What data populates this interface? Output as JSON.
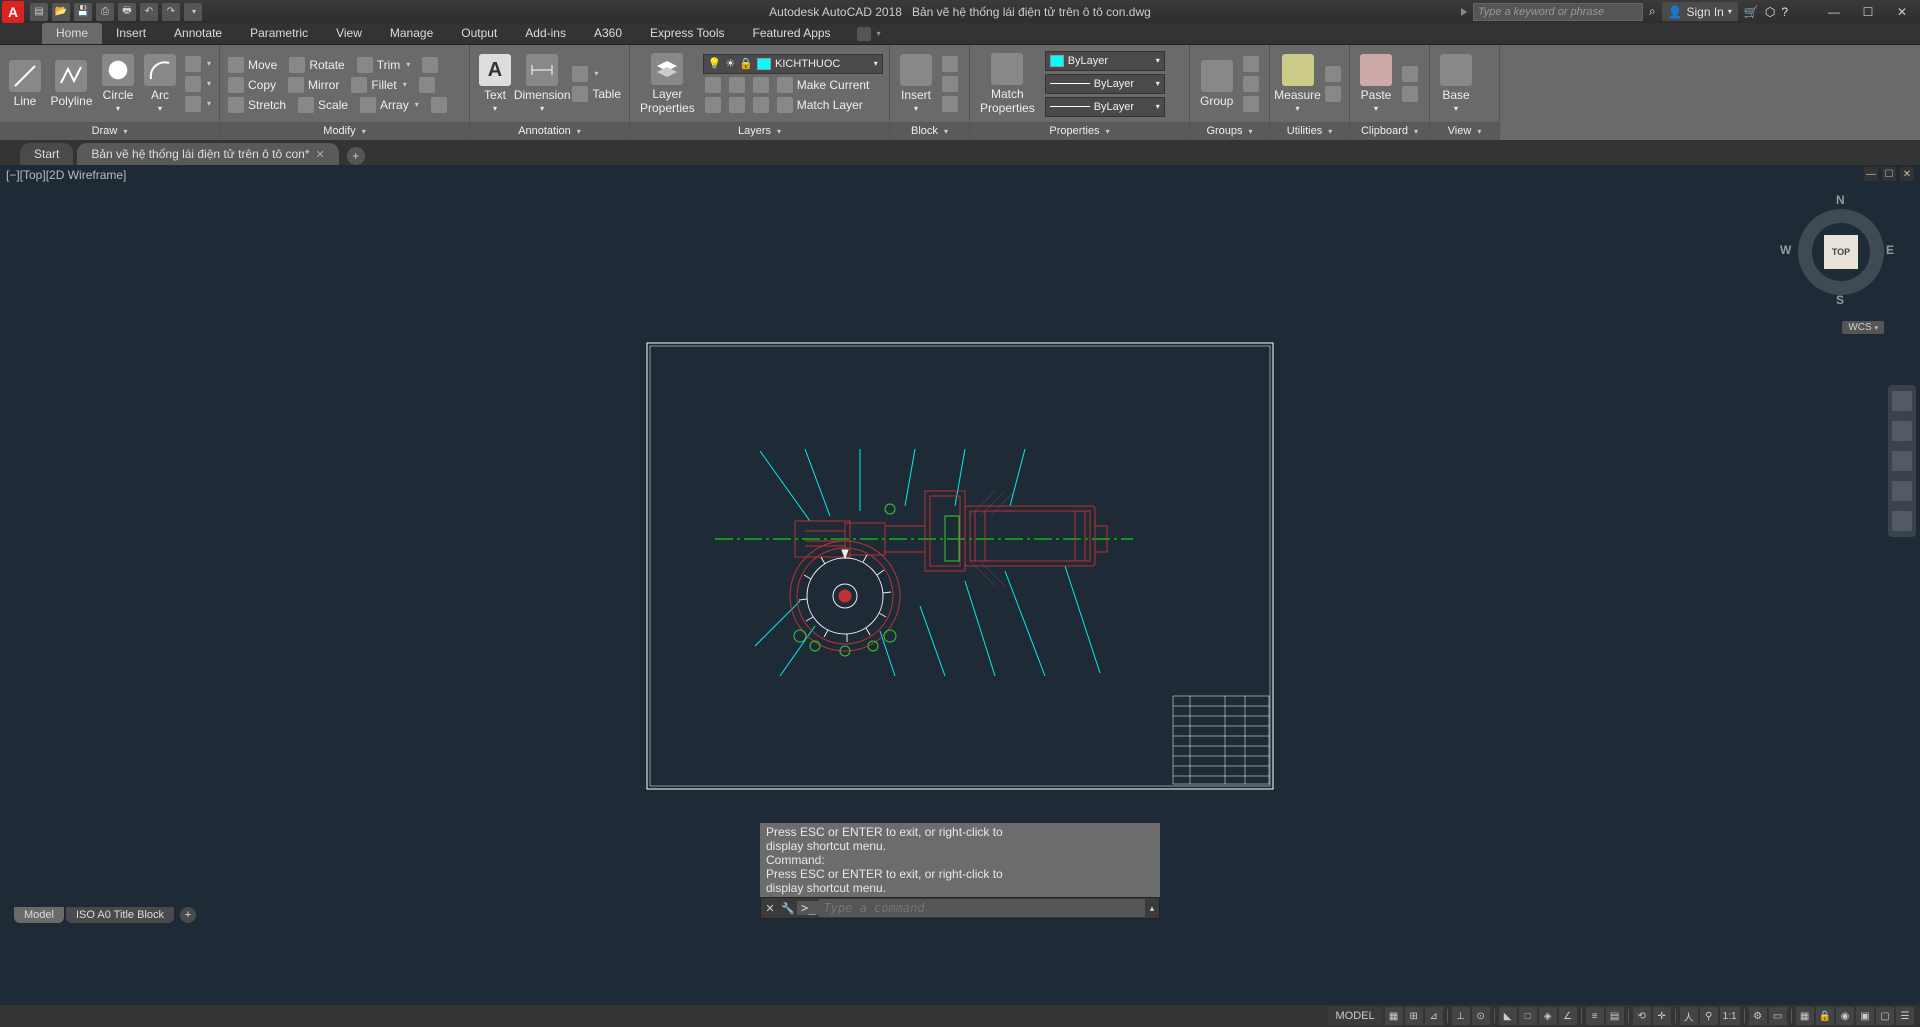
{
  "app": {
    "name": "Autodesk AutoCAD 2018",
    "filename": "Bản vẽ hệ thống lái điện tử trên ô tô con.dwg",
    "logo_letter": "A"
  },
  "titlebar": {
    "search_placeholder": "Type a keyword or phrase",
    "sign_in": "Sign In"
  },
  "ribbon_tabs": [
    "Home",
    "Insert",
    "Annotate",
    "Parametric",
    "View",
    "Manage",
    "Output",
    "Add-ins",
    "A360",
    "Express Tools",
    "Featured Apps"
  ],
  "active_tab": 0,
  "panels": {
    "draw": {
      "title": "Draw",
      "items": [
        "Line",
        "Polyline",
        "Circle",
        "Arc"
      ]
    },
    "modify": {
      "title": "Modify",
      "rows": [
        [
          "Move",
          "Rotate",
          "Trim"
        ],
        [
          "Copy",
          "Mirror",
          "Fillet"
        ],
        [
          "Stretch",
          "Scale",
          "Array"
        ]
      ]
    },
    "annotation": {
      "title": "Annotation",
      "items": [
        "Text",
        "Dimension",
        "Table"
      ]
    },
    "layers": {
      "title": "Layers",
      "btn": "Layer\nProperties",
      "current": "KICHTHUOC",
      "rows": [
        "Make Current",
        "Match Layer"
      ]
    },
    "block": {
      "title": "Block",
      "btn": "Insert"
    },
    "properties": {
      "title": "Properties",
      "btn": "Match\nProperties",
      "dd": [
        "ByLayer",
        "ByLayer",
        "ByLayer"
      ]
    },
    "groups": {
      "title": "Groups",
      "btn": "Group"
    },
    "utilities": {
      "title": "Utilities",
      "btn": "Measure"
    },
    "clipboard": {
      "title": "Clipboard",
      "btn": "Paste"
    },
    "view": {
      "title": "View",
      "btn": "Base"
    }
  },
  "doc_tabs": [
    {
      "label": "Start",
      "active": false
    },
    {
      "label": "Bản vẽ hệ thống lái điện tử trên ô tô con*",
      "active": true
    }
  ],
  "viewport": {
    "label": "[−][Top][2D Wireframe]",
    "cube": "TOP",
    "wcs": "WCS"
  },
  "compass": {
    "n": "N",
    "s": "S",
    "e": "E",
    "w": "W"
  },
  "command": {
    "history": [
      "Press ESC or ENTER to exit, or right-click to",
      "display shortcut menu.",
      "Command:",
      "Press ESC or ENTER to exit, or right-click to",
      "display shortcut menu."
    ],
    "prompt": ">_",
    "placeholder": "Type a command"
  },
  "bottom_tabs": [
    {
      "label": "Model",
      "active": true
    },
    {
      "label": "ISO A0 Title Block",
      "active": false
    }
  ],
  "status": {
    "model": "MODEL",
    "scale": "1:1"
  }
}
